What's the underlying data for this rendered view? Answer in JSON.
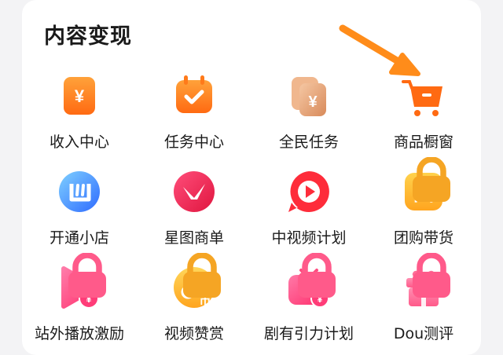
{
  "section": {
    "title": "内容变现"
  },
  "items": [
    {
      "label": "收入中心",
      "icon": "yuan-wallet-icon",
      "locked": false
    },
    {
      "label": "任务中心",
      "icon": "calendar-check-icon",
      "locked": false
    },
    {
      "label": "全民任务",
      "icon": "coin-cards-icon",
      "locked": false
    },
    {
      "label": "商品橱窗",
      "icon": "shopping-cart-icon",
      "locked": false
    },
    {
      "label": "开通小店",
      "icon": "shop-badge-icon",
      "locked": false
    },
    {
      "label": "星图商单",
      "icon": "star-map-icon",
      "locked": false
    },
    {
      "label": "中视频计划",
      "icon": "play-circle-icon",
      "locked": false
    },
    {
      "label": "团购带货",
      "icon": "group-buy-icon",
      "locked": true
    },
    {
      "label": "站外播放激励",
      "icon": "play-yuan-icon",
      "locked": true
    },
    {
      "label": "视频赞赏",
      "icon": "tiktok-coin-icon",
      "locked": true
    },
    {
      "label": "剧有引力计划",
      "icon": "tv-yuan-icon",
      "locked": true
    },
    {
      "label": "Dou测评",
      "icon": "gift-box-icon",
      "locked": true
    }
  ],
  "colors": {
    "orange": "#ff7a1a",
    "red": "#fe2c55",
    "blue": "#2f7bff",
    "yellow": "#ffbe2e",
    "pink": "#ff5a8a",
    "arrow": "#ff8c1a"
  }
}
